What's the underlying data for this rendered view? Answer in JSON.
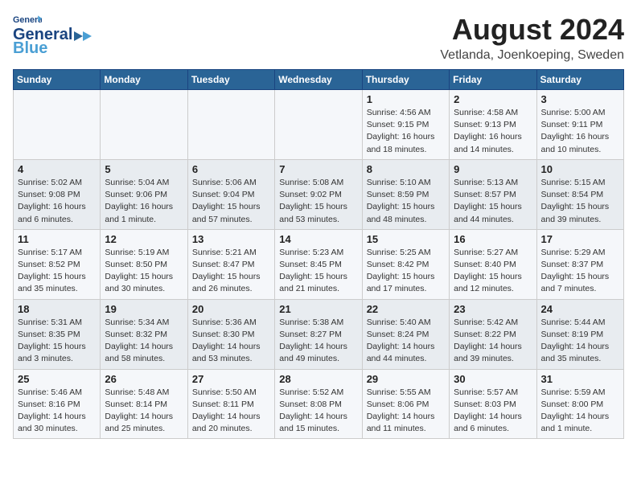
{
  "header": {
    "logo_general": "General",
    "logo_blue": "Blue",
    "month": "August 2024",
    "location": "Vetlanda, Joenkoeping, Sweden"
  },
  "weekdays": [
    "Sunday",
    "Monday",
    "Tuesday",
    "Wednesday",
    "Thursday",
    "Friday",
    "Saturday"
  ],
  "weeks": [
    [
      {
        "day": "",
        "info": ""
      },
      {
        "day": "",
        "info": ""
      },
      {
        "day": "",
        "info": ""
      },
      {
        "day": "",
        "info": ""
      },
      {
        "day": "1",
        "info": "Sunrise: 4:56 AM\nSunset: 9:15 PM\nDaylight: 16 hours\nand 18 minutes."
      },
      {
        "day": "2",
        "info": "Sunrise: 4:58 AM\nSunset: 9:13 PM\nDaylight: 16 hours\nand 14 minutes."
      },
      {
        "day": "3",
        "info": "Sunrise: 5:00 AM\nSunset: 9:11 PM\nDaylight: 16 hours\nand 10 minutes."
      }
    ],
    [
      {
        "day": "4",
        "info": "Sunrise: 5:02 AM\nSunset: 9:08 PM\nDaylight: 16 hours\nand 6 minutes."
      },
      {
        "day": "5",
        "info": "Sunrise: 5:04 AM\nSunset: 9:06 PM\nDaylight: 16 hours\nand 1 minute."
      },
      {
        "day": "6",
        "info": "Sunrise: 5:06 AM\nSunset: 9:04 PM\nDaylight: 15 hours\nand 57 minutes."
      },
      {
        "day": "7",
        "info": "Sunrise: 5:08 AM\nSunset: 9:02 PM\nDaylight: 15 hours\nand 53 minutes."
      },
      {
        "day": "8",
        "info": "Sunrise: 5:10 AM\nSunset: 8:59 PM\nDaylight: 15 hours\nand 48 minutes."
      },
      {
        "day": "9",
        "info": "Sunrise: 5:13 AM\nSunset: 8:57 PM\nDaylight: 15 hours\nand 44 minutes."
      },
      {
        "day": "10",
        "info": "Sunrise: 5:15 AM\nSunset: 8:54 PM\nDaylight: 15 hours\nand 39 minutes."
      }
    ],
    [
      {
        "day": "11",
        "info": "Sunrise: 5:17 AM\nSunset: 8:52 PM\nDaylight: 15 hours\nand 35 minutes."
      },
      {
        "day": "12",
        "info": "Sunrise: 5:19 AM\nSunset: 8:50 PM\nDaylight: 15 hours\nand 30 minutes."
      },
      {
        "day": "13",
        "info": "Sunrise: 5:21 AM\nSunset: 8:47 PM\nDaylight: 15 hours\nand 26 minutes."
      },
      {
        "day": "14",
        "info": "Sunrise: 5:23 AM\nSunset: 8:45 PM\nDaylight: 15 hours\nand 21 minutes."
      },
      {
        "day": "15",
        "info": "Sunrise: 5:25 AM\nSunset: 8:42 PM\nDaylight: 15 hours\nand 17 minutes."
      },
      {
        "day": "16",
        "info": "Sunrise: 5:27 AM\nSunset: 8:40 PM\nDaylight: 15 hours\nand 12 minutes."
      },
      {
        "day": "17",
        "info": "Sunrise: 5:29 AM\nSunset: 8:37 PM\nDaylight: 15 hours\nand 7 minutes."
      }
    ],
    [
      {
        "day": "18",
        "info": "Sunrise: 5:31 AM\nSunset: 8:35 PM\nDaylight: 15 hours\nand 3 minutes."
      },
      {
        "day": "19",
        "info": "Sunrise: 5:34 AM\nSunset: 8:32 PM\nDaylight: 14 hours\nand 58 minutes."
      },
      {
        "day": "20",
        "info": "Sunrise: 5:36 AM\nSunset: 8:30 PM\nDaylight: 14 hours\nand 53 minutes."
      },
      {
        "day": "21",
        "info": "Sunrise: 5:38 AM\nSunset: 8:27 PM\nDaylight: 14 hours\nand 49 minutes."
      },
      {
        "day": "22",
        "info": "Sunrise: 5:40 AM\nSunset: 8:24 PM\nDaylight: 14 hours\nand 44 minutes."
      },
      {
        "day": "23",
        "info": "Sunrise: 5:42 AM\nSunset: 8:22 PM\nDaylight: 14 hours\nand 39 minutes."
      },
      {
        "day": "24",
        "info": "Sunrise: 5:44 AM\nSunset: 8:19 PM\nDaylight: 14 hours\nand 35 minutes."
      }
    ],
    [
      {
        "day": "25",
        "info": "Sunrise: 5:46 AM\nSunset: 8:16 PM\nDaylight: 14 hours\nand 30 minutes."
      },
      {
        "day": "26",
        "info": "Sunrise: 5:48 AM\nSunset: 8:14 PM\nDaylight: 14 hours\nand 25 minutes."
      },
      {
        "day": "27",
        "info": "Sunrise: 5:50 AM\nSunset: 8:11 PM\nDaylight: 14 hours\nand 20 minutes."
      },
      {
        "day": "28",
        "info": "Sunrise: 5:52 AM\nSunset: 8:08 PM\nDaylight: 14 hours\nand 15 minutes."
      },
      {
        "day": "29",
        "info": "Sunrise: 5:55 AM\nSunset: 8:06 PM\nDaylight: 14 hours\nand 11 minutes."
      },
      {
        "day": "30",
        "info": "Sunrise: 5:57 AM\nSunset: 8:03 PM\nDaylight: 14 hours\nand 6 minutes."
      },
      {
        "day": "31",
        "info": "Sunrise: 5:59 AM\nSunset: 8:00 PM\nDaylight: 14 hours\nand 1 minute."
      }
    ]
  ]
}
